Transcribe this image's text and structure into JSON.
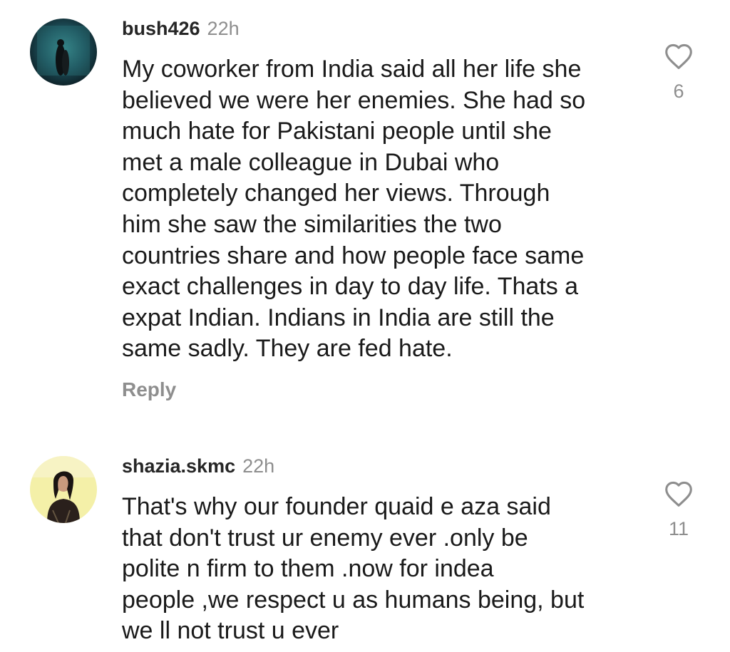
{
  "comments": [
    {
      "username": "bush426",
      "time": "22h",
      "text": "My coworker from India said all her life she\nbelieved we were her enemies. She had so\nmuch hate for Pakistani people until she\nmet a male colleague in Dubai who\ncompletely changed her views. Through\nhim she saw the similarities the two\ncountries share and how people face same\nexact challenges in day to day life. Thats a\nexpat Indian. Indians in India are still the\nsame sadly. They are fed hate.",
      "reply_label": "Reply",
      "likes": "6",
      "like_icon": "heart-outline-icon"
    },
    {
      "username": "shazia.skmc",
      "time": "22h",
      "text": "That's why our founder quaid e aza said\nthat don't trust ur enemy  ever .only be\npolite n firm to them .now for indea\npeople ,we respect u as humans being, but\nwe ll not trust u ever",
      "likes": "11",
      "like_icon": "heart-outline-icon"
    }
  ],
  "colors": {
    "text": "#262626",
    "secondary": "#8e8e8e"
  }
}
